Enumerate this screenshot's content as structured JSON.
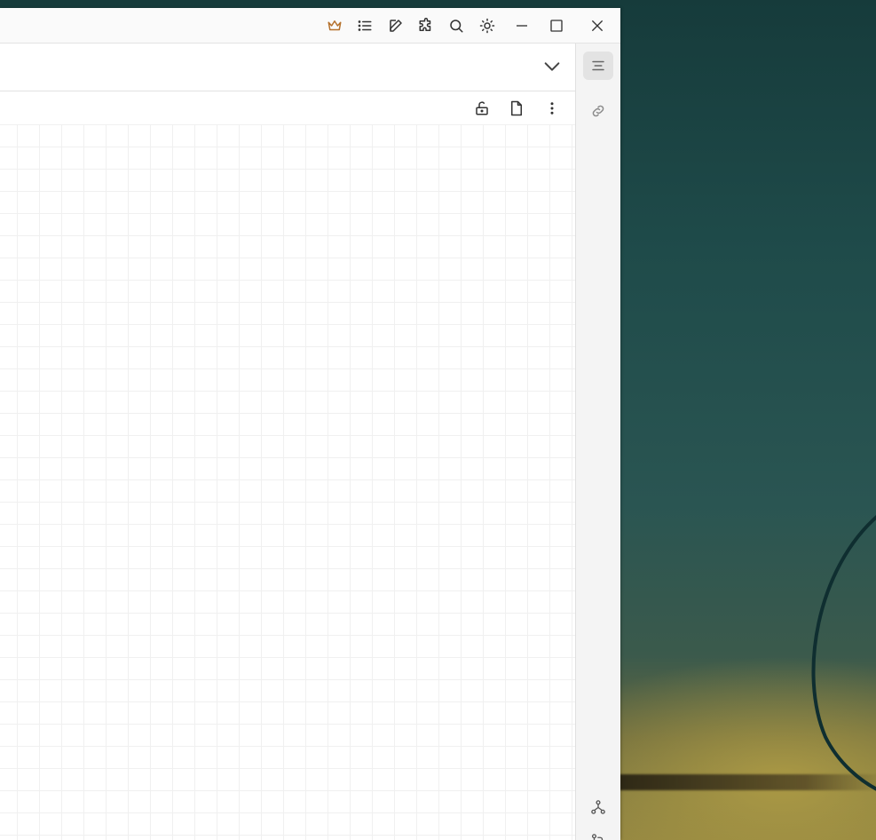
{
  "window": {
    "titlebar_icons": [
      "crown-icon",
      "list-icon",
      "edit-icon",
      "puzzle-icon",
      "search-icon",
      "sun-icon",
      "minimize-icon",
      "maximize-icon",
      "close-icon"
    ],
    "accent_color": "#b5712c"
  },
  "tabbar": {
    "icons": [
      "chevron-down-icon"
    ]
  },
  "toolbar": {
    "icons": [
      "unlock-icon",
      "file-icon",
      "more-vertical-icon"
    ]
  },
  "right_rail": {
    "top_icons": [
      "outline-icon",
      "link-icon"
    ],
    "bottom_icons": [
      "graph-icon",
      "git-compare-icon"
    ]
  }
}
